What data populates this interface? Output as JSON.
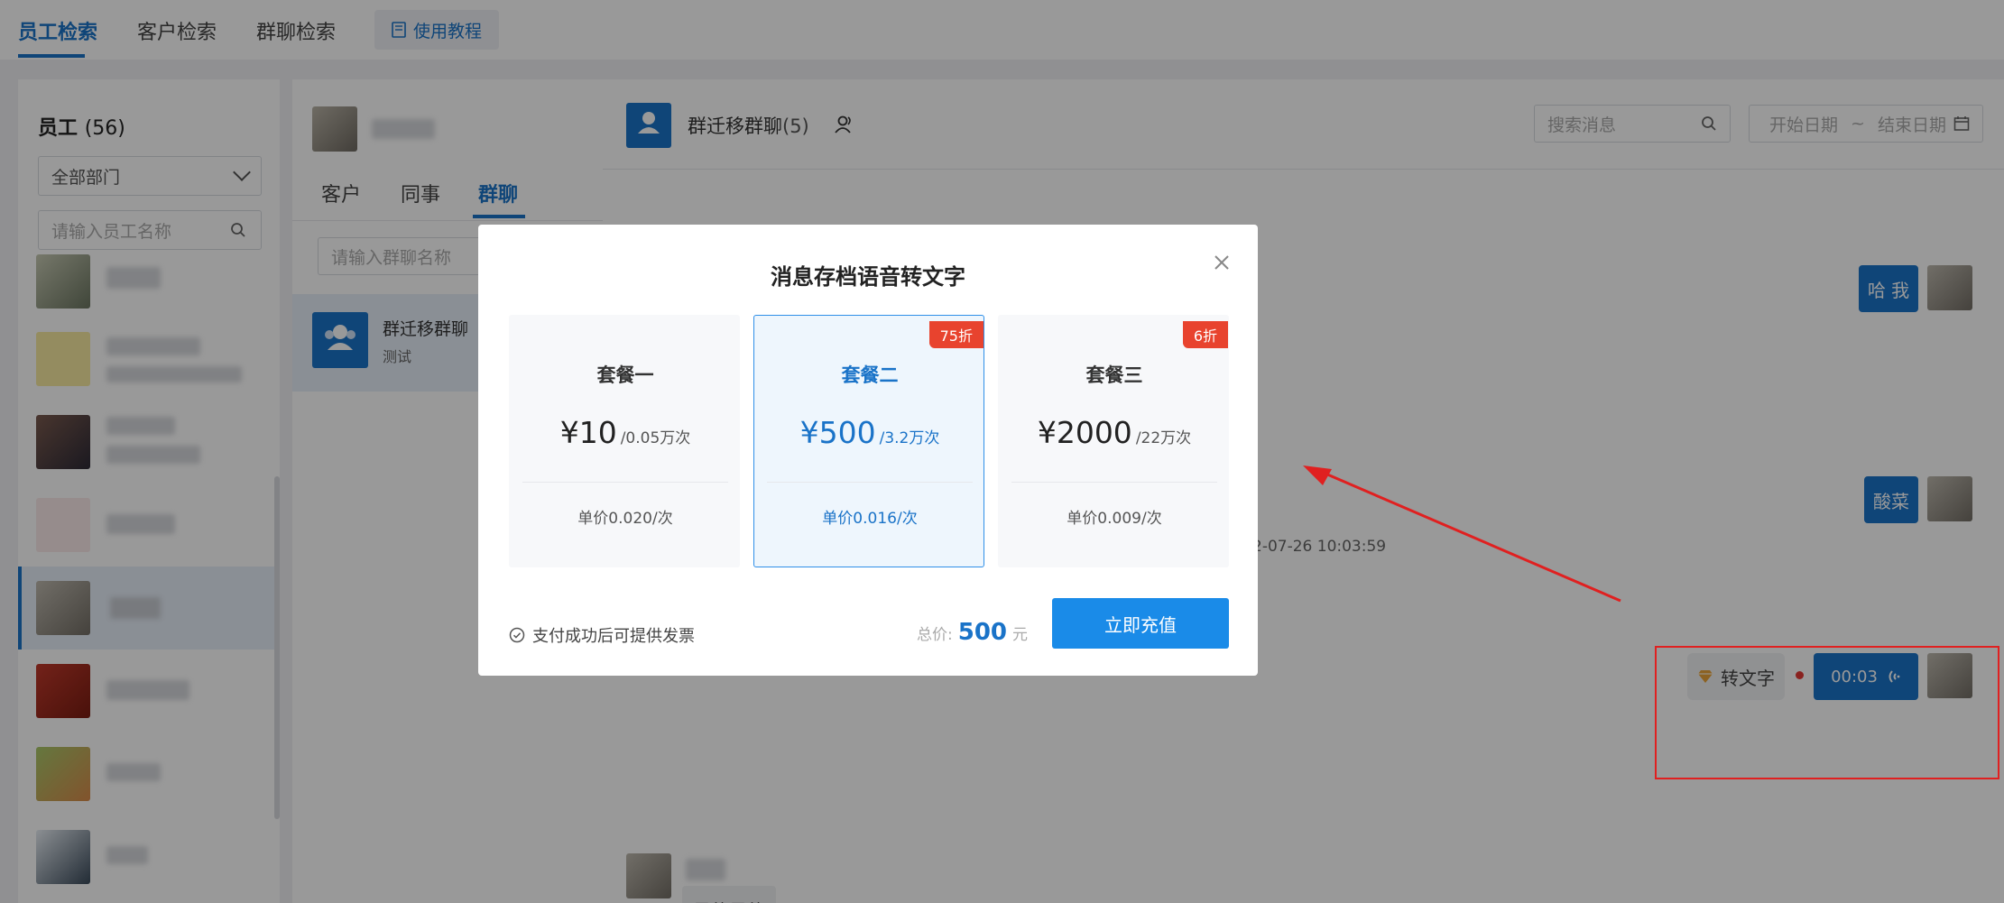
{
  "nav": {
    "tabs": [
      {
        "label": "员工检索"
      },
      {
        "label": "客户检索"
      },
      {
        "label": "群聊检索"
      }
    ],
    "tutorial_label": "使用教程"
  },
  "employee_panel": {
    "title": "员工",
    "count": "(56)",
    "department_select": "全部部门",
    "search_placeholder": "请输入员工名称"
  },
  "middle_panel": {
    "tabs": [
      {
        "label": "客户"
      },
      {
        "label": "同事"
      },
      {
        "label": "群聊"
      }
    ],
    "search_placeholder": "请输入群聊名称",
    "group_item": {
      "name": "群迁移群聊",
      "subtitle": "测试",
      "avatar_label": "群聊"
    }
  },
  "chat": {
    "group_name": "群迁移群聊",
    "member_count": "(5)",
    "avatar_label": "群聊",
    "search_placeholder": "搜索消息",
    "date_start": "开始日期",
    "date_sep": "~",
    "date_end": "结束日期",
    "messages": {
      "msg1": "哈 我",
      "msg2": "酸菜",
      "timestamp": "2-07-26 10:03:59",
      "to_text_label": "转文字",
      "voice_duration": "00:03",
      "incoming": "是的是的"
    }
  },
  "modal": {
    "title": "消息存档语音转文字",
    "plans": [
      {
        "name": "套餐一",
        "price": "¥10",
        "quota": "/0.05万次",
        "unit_price": "单价0.020/次",
        "badge": ""
      },
      {
        "name": "套餐二",
        "price": "¥500",
        "quota": "/3.2万次",
        "unit_price": "单价0.016/次",
        "badge": "75折"
      },
      {
        "name": "套餐三",
        "price": "¥2000",
        "quota": "/22万次",
        "unit_price": "单价0.009/次",
        "badge": "6折"
      }
    ],
    "invoice_note": "支付成功后可提供发票",
    "total_label": "总价:",
    "total_value": "500",
    "total_unit": "元",
    "pay_button": "立即充值"
  },
  "colors": {
    "accent": "#1a73c8",
    "badge": "#e8432e",
    "annotation": "#e02020"
  }
}
